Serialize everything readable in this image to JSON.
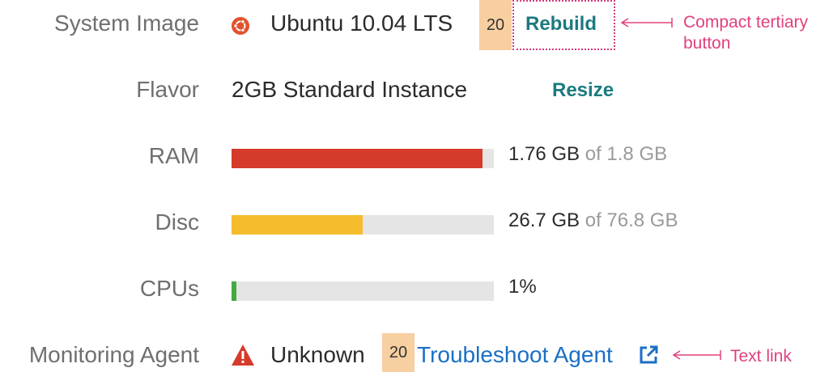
{
  "rows": {
    "system_image": {
      "label": "System Image",
      "os_icon": "ubuntu-icon",
      "value": "Ubuntu 10.04 LTS",
      "badge": "20",
      "action_label": "Rebuild"
    },
    "flavor": {
      "label": "Flavor",
      "value": "2GB Standard Instance",
      "action_label": "Resize"
    },
    "ram": {
      "label": "RAM",
      "used": "1.76 GB",
      "total": "of 1.8 GB",
      "fraction": 0.956,
      "color": "#d53a2b"
    },
    "disc": {
      "label": "Disc",
      "used": "26.7 GB",
      "total": "of 76.8 GB",
      "fraction": 0.5,
      "color": "#f5bd2d"
    },
    "cpus": {
      "label": "CPUs",
      "used": "1%",
      "fraction": 0.01,
      "color": "#46a842"
    },
    "monitoring_agent": {
      "label": "Monitoring Agent",
      "status_icon": "warning-icon",
      "value": "Unknown",
      "badge": "20",
      "link_label": "Troubleshoot Agent",
      "link_icon": "external-link-icon"
    }
  },
  "annotations": {
    "tertiary_button": "Compact tertiary button",
    "text_link": "Text link"
  },
  "colors": {
    "label": "#6f6f6f",
    "accent": "#1c7a80",
    "link": "#1a6fc4",
    "annotation": "#e0407f",
    "badge_bg": "#f8cfa0"
  }
}
